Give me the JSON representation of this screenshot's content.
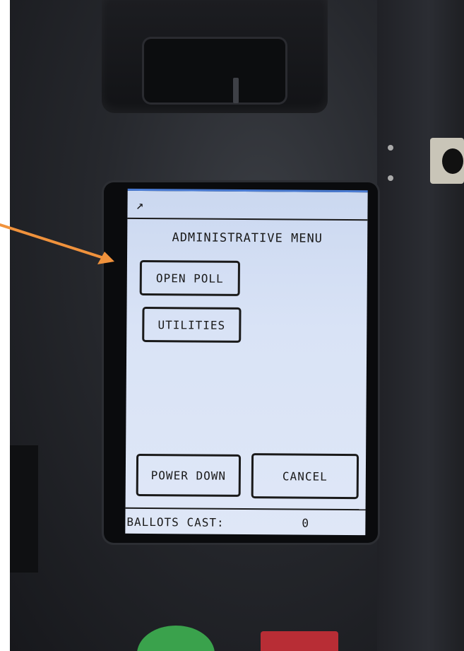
{
  "device": {
    "screen": {
      "title": "ADMINISTRATIVE MENU",
      "buttons": {
        "open_poll": "OPEN POLL",
        "utilities": "UTILITIES",
        "power_down": "POWER DOWN",
        "cancel": "CANCEL"
      },
      "status": {
        "label": "BALLOTS CAST:",
        "value": "0"
      },
      "accent_color": "#4a7bd3",
      "background_color": "#d9e3f6"
    }
  },
  "annotation": {
    "arrow_color": "#f0923c",
    "icon": "arrow-right-icon"
  }
}
